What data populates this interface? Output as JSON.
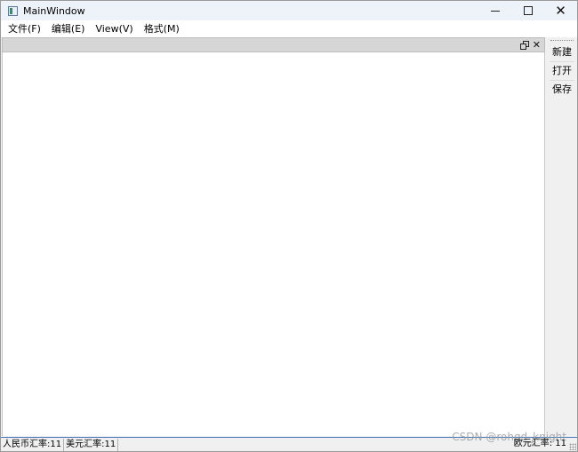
{
  "window": {
    "title": "MainWindow",
    "minimize": "—",
    "maximize": "□",
    "close": "✕"
  },
  "menu": [
    {
      "label": "文件(F)"
    },
    {
      "label": "编辑(E)"
    },
    {
      "label": "View(V)"
    },
    {
      "label": "格式(M)"
    }
  ],
  "dock": {
    "close_glyph": "✕"
  },
  "toolbar": {
    "items": [
      "新建",
      "打开",
      "保存"
    ]
  },
  "statusbar": {
    "rmb_rate": "人民币汇率:11",
    "usd_rate": "美元汇率:11",
    "eur_rate": "欧元汇率: 11",
    "watermark": "CSDN @rohgd_knight"
  }
}
